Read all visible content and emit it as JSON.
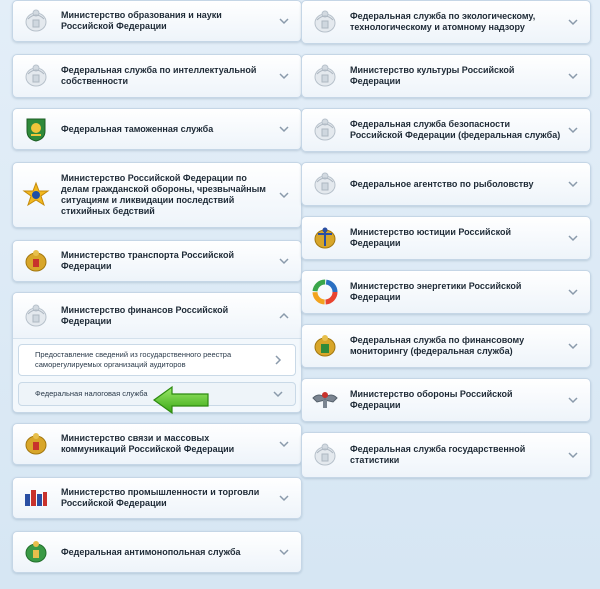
{
  "left_column": [
    {
      "label": "Министерство образования и науки Российской Федерации",
      "emblem": "eagle-icon"
    },
    {
      "label": "Федеральная служба по интеллектуальной собственности",
      "emblem": "eagle-icon"
    },
    {
      "label": "Федеральная таможенная служба",
      "emblem": "customs-emblem-icon"
    },
    {
      "label": "Министерство Российской Федерации по делам гражданской обороны, чрезвычайным ситуациям и ликвидации последствий стихийных бедствий",
      "emblem": "emergency-emblem-icon"
    },
    {
      "label": "Министерство транспорта Российской Федерации",
      "emblem": "gold-eagle-icon"
    }
  ],
  "expanded_group": {
    "label": "Министерство финансов Российской Федерации",
    "emblem": "eagle-icon",
    "subitems": [
      {
        "label": "Предоставление сведений из государственного реестра саморегулируемых организаций аудиторов"
      },
      {
        "label": "Федеральная налоговая служба"
      }
    ]
  },
  "left_column_after": [
    {
      "label": "Министерство связи и массовых коммуникаций Российской Федерации",
      "emblem": "gold-eagle-icon"
    },
    {
      "label": "Министерство промышленности и торговли Российской Федерации",
      "emblem": "industry-emblem-icon"
    },
    {
      "label": "Федеральная антимонопольная служба",
      "emblem": "antimonopoly-emblem-icon"
    }
  ],
  "right_column": [
    {
      "label": "Федеральная служба по экологическому, технологическому и атомному надзору",
      "emblem": "eagle-icon"
    },
    {
      "label": "Министерство культуры Российской Федерации",
      "emblem": "eagle-icon"
    },
    {
      "label": "Федеральная служба безопасности Российской Федерации (федеральная служба)",
      "emblem": "eagle-icon"
    },
    {
      "label": "Федеральное агентство по рыболовству",
      "emblem": "eagle-icon"
    },
    {
      "label": "Министерство юстиции Российской Федерации",
      "emblem": "justice-emblem-icon"
    },
    {
      "label": "Министерство энергетики Российской Федерации",
      "emblem": "energy-logo-icon"
    },
    {
      "label": "Федеральная служба по финансовому мониторингу (федеральная служба)",
      "emblem": "finmonitoring-emblem-icon"
    },
    {
      "label": "Министерство обороны Российской Федерации",
      "emblem": "defense-eagle-icon"
    },
    {
      "label": "Федеральная служба государственной статистики",
      "emblem": "eagle-icon"
    }
  ],
  "colors": {
    "background": "#dde9f5",
    "card_border": "#c5d6e6",
    "text": "#1e2a36",
    "arrow_green": "#4cc21f"
  }
}
